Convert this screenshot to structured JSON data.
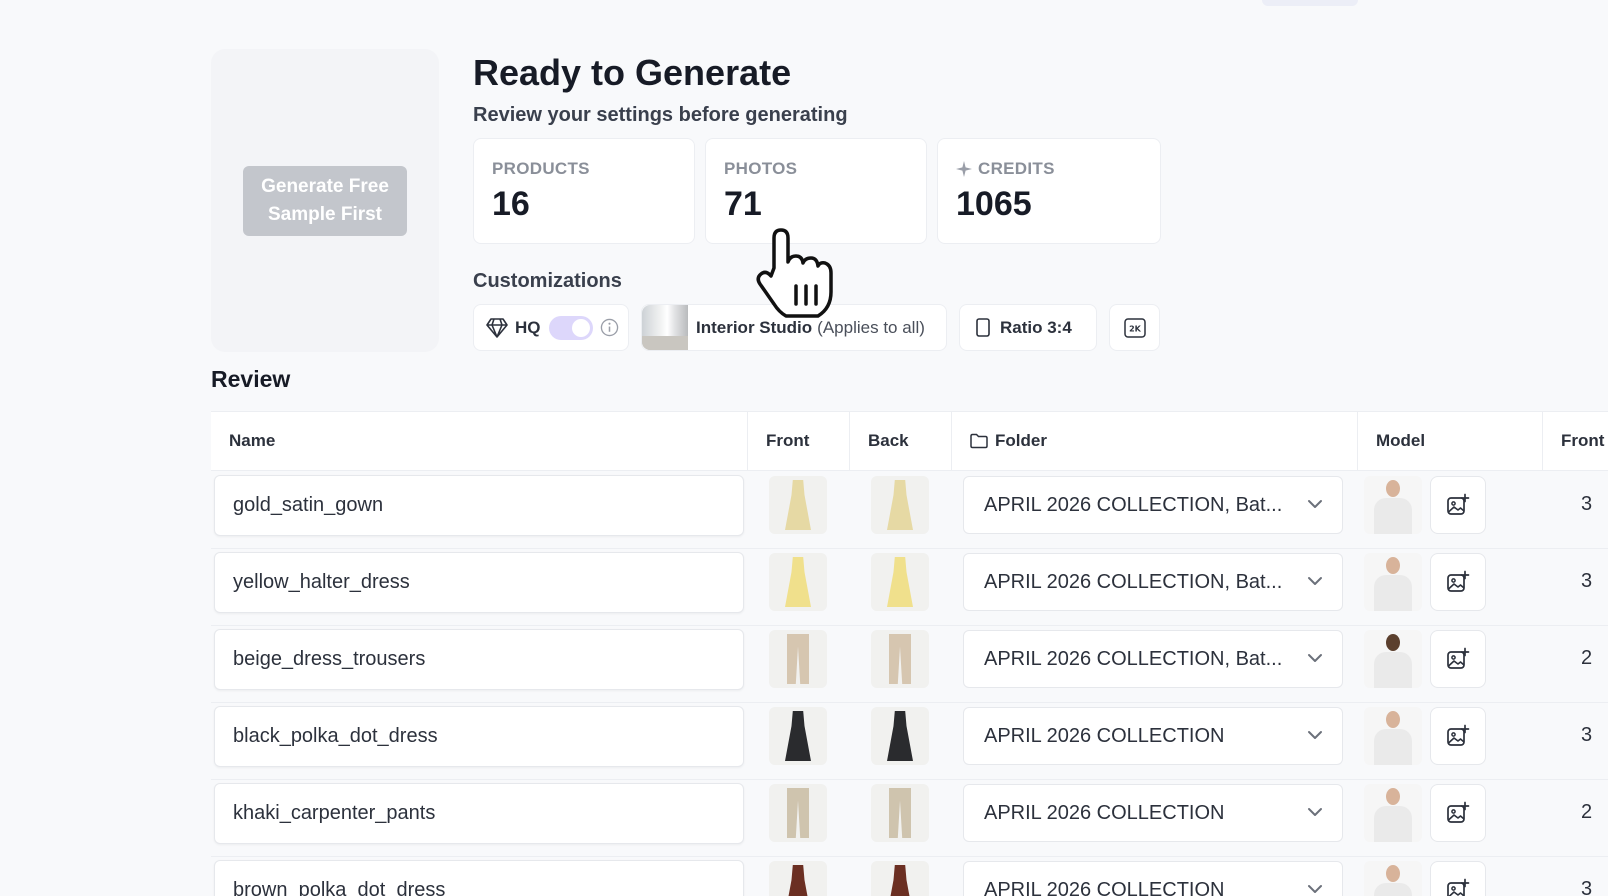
{
  "sample": {
    "button_label": "Generate Free Sample First"
  },
  "header": {
    "title": "Ready to Generate",
    "subtitle": "Review your settings before generating"
  },
  "stats": {
    "products": {
      "label": "PRODUCTS",
      "value": "16"
    },
    "photos": {
      "label": "PHOTOS",
      "value": "71"
    },
    "credits": {
      "label": "CREDITS",
      "value": "1065",
      "icon": "sparkle-icon"
    }
  },
  "customizations": {
    "title": "Customizations",
    "hq": {
      "label": "HQ",
      "enabled": true,
      "icon": "diamond-icon"
    },
    "background": {
      "name": "Interior Studio",
      "note": "(Applies to all)"
    },
    "ratio": {
      "label": "Ratio 3:4"
    },
    "resolution": {
      "label": "2K"
    }
  },
  "review": {
    "title": "Review",
    "columns": {
      "name": "Name",
      "front": "Front",
      "back": "Back",
      "folder": "Folder",
      "model": "Model",
      "front_count": "Front"
    },
    "rows": [
      {
        "name": "gold_satin_gown",
        "folder": "APRIL 2026 COLLECTION, Bat...",
        "count": "3",
        "garment": "dress",
        "color": "#e6d9a4",
        "model_color": "#d8b39a"
      },
      {
        "name": "yellow_halter_dress",
        "folder": "APRIL 2026 COLLECTION, Bat...",
        "count": "3",
        "garment": "dress",
        "color": "#f0e08c",
        "model_color": "#d8b39a"
      },
      {
        "name": "beige_dress_trousers",
        "folder": "APRIL 2026 COLLECTION, Bat...",
        "count": "2",
        "garment": "pants",
        "color": "#d6c6b0",
        "model_color": "#5b3f2d"
      },
      {
        "name": "black_polka_dot_dress",
        "folder": "APRIL 2026 COLLECTION",
        "count": "3",
        "garment": "dress",
        "color": "#2a2b2e",
        "model_color": "#d8b39a"
      },
      {
        "name": "khaki_carpenter_pants",
        "folder": "APRIL 2026 COLLECTION",
        "count": "2",
        "garment": "pants",
        "color": "#cfc4ae",
        "model_color": "#d8b39a"
      },
      {
        "name": "brown_polka_dot_dress",
        "folder": "APRIL 2026 COLLECTION",
        "count": "3",
        "garment": "dress",
        "color": "#6b2f22",
        "model_color": "#d8b39a"
      }
    ]
  },
  "colors": {
    "accent": "#ddd7fb",
    "disabled_button": "#c3c6cc",
    "background": "#f8f9fb"
  }
}
